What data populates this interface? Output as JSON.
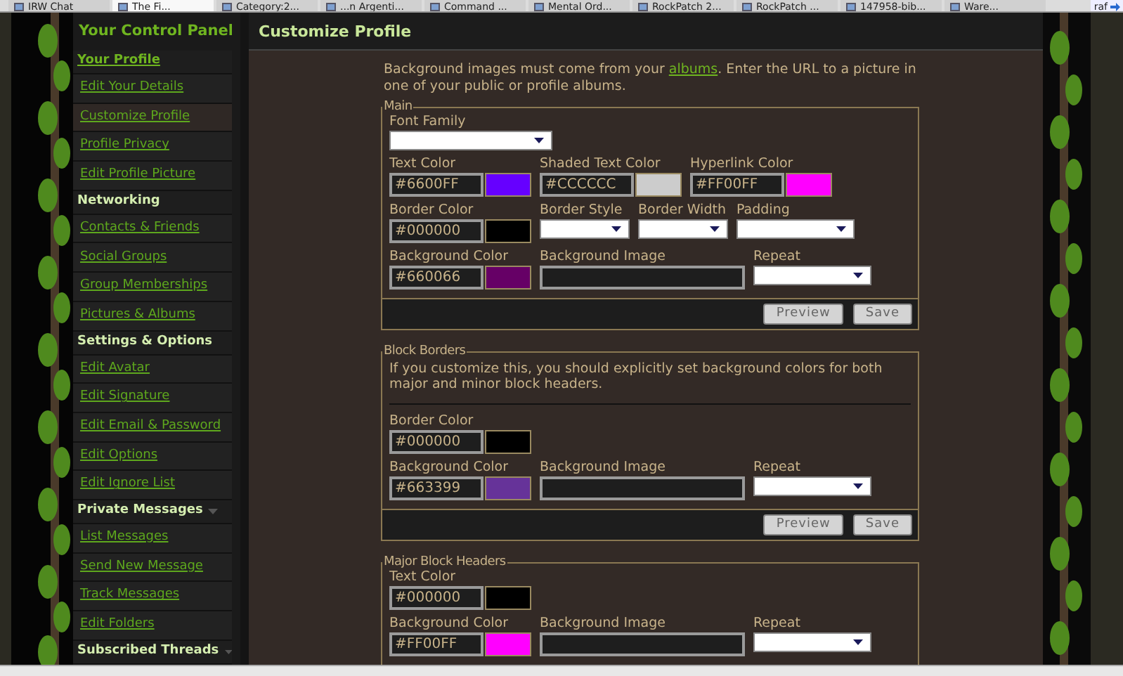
{
  "browser_tabs": [
    {
      "label": "IRW Chat",
      "selected": false
    },
    {
      "label": "The Fi...",
      "selected": true
    },
    {
      "label": "Category:2...",
      "selected": false
    },
    {
      "label": "...n Argenti...",
      "selected": false
    },
    {
      "label": "Command ...",
      "selected": false
    },
    {
      "label": "Mental Ord...",
      "selected": false
    },
    {
      "label": "RockPatch 2...",
      "selected": false
    },
    {
      "label": "RockPatch ...",
      "selected": false
    },
    {
      "label": "147958-bib...",
      "selected": false
    },
    {
      "label": "Ware...",
      "selected": false
    }
  ],
  "tab_overflow": {
    "label": "raf"
  },
  "sidebar": {
    "title": "Your Control Panel",
    "groups": [
      {
        "heading": "Your Profile",
        "kind": "link",
        "collapsible": false,
        "items": [
          {
            "label": "Edit Your Details",
            "selected": false
          },
          {
            "label": "Customize Profile",
            "selected": true
          },
          {
            "label": "Profile Privacy",
            "selected": false
          },
          {
            "label": "Edit Profile Picture",
            "selected": false
          }
        ]
      },
      {
        "heading": "Networking",
        "kind": "plain",
        "collapsible": false,
        "items": [
          {
            "label": "Contacts & Friends",
            "selected": false
          },
          {
            "label": "Social Groups",
            "selected": false
          },
          {
            "label": "Group Memberships",
            "selected": false
          },
          {
            "label": "Pictures & Albums",
            "selected": false
          }
        ]
      },
      {
        "heading": "Settings & Options",
        "kind": "plain",
        "collapsible": false,
        "items": [
          {
            "label": "Edit Avatar",
            "selected": false
          },
          {
            "label": "Edit Signature",
            "selected": false
          },
          {
            "label": "Edit Email & Password",
            "selected": false
          },
          {
            "label": "Edit Options",
            "selected": false
          },
          {
            "label": "Edit Ignore List",
            "selected": false
          }
        ]
      },
      {
        "heading": "Private Messages",
        "kind": "plain",
        "collapsible": true,
        "items": [
          {
            "label": "List Messages",
            "selected": false
          },
          {
            "label": "Send New Message",
            "selected": false
          },
          {
            "label": "Track Messages",
            "selected": false
          },
          {
            "label": "Edit Folders",
            "selected": false
          }
        ]
      },
      {
        "heading": "Subscribed Threads",
        "kind": "plain",
        "collapsible": true
      }
    ]
  },
  "main": {
    "title": "Customize Profile",
    "intro": {
      "before": "Background images must come from your",
      "link": "albums",
      "after": ". Enter the URL to a picture in one of your public or profile albums."
    },
    "sections": [
      {
        "legend": "Main",
        "rows": [
          [
            {
              "kind": "select_wide",
              "label": "Font Family"
            }
          ],
          [
            {
              "kind": "color",
              "label": "Text Color",
              "value": "#6600FF",
              "color": "#6600ff"
            },
            {
              "kind": "color",
              "label": "Shaded Text Color",
              "value": "#CCCCCC",
              "color": "#cccccc"
            },
            {
              "kind": "color",
              "label": "Hyperlink Color",
              "value": "#FF00FF",
              "color": "#ff00ff"
            }
          ],
          [
            {
              "kind": "color",
              "label": "Border Color",
              "value": "#000000",
              "color": "#000000"
            },
            {
              "kind": "select_narrow",
              "label": "Border Style"
            },
            {
              "kind": "select_narrow",
              "label": "Border Width"
            },
            {
              "kind": "select",
              "label": "Padding"
            }
          ],
          [
            {
              "kind": "color",
              "label": "Background Color",
              "value": "#660066",
              "color": "#660066"
            },
            {
              "kind": "image",
              "label": "Background Image"
            },
            {
              "kind": "select",
              "label": "Repeat"
            }
          ]
        ],
        "buttons": [
          "Preview",
          "Save"
        ]
      },
      {
        "legend": "Block Borders",
        "note": "If you customize this, you should explicitly set background colors for both major and minor block headers.",
        "rows": [
          [
            {
              "kind": "color",
              "label": "Border Color",
              "value": "#000000",
              "color": "#000000"
            }
          ],
          [
            {
              "kind": "color",
              "label": "Background Color",
              "value": "#663399",
              "color": "#663399"
            },
            {
              "kind": "image",
              "label": "Background Image"
            },
            {
              "kind": "select",
              "label": "Repeat"
            }
          ]
        ],
        "buttons": [
          "Preview",
          "Save"
        ]
      },
      {
        "legend": "Major Block Headers",
        "rows": [
          [
            {
              "kind": "color",
              "label": "Text Color",
              "value": "#000000",
              "color": "#000000"
            }
          ],
          [
            {
              "kind": "color",
              "label": "Background Color",
              "value": "#FF00FF",
              "color": "#ff00ff"
            },
            {
              "kind": "image",
              "label": "Background Image"
            },
            {
              "kind": "select",
              "label": "Repeat"
            }
          ]
        ]
      }
    ]
  }
}
